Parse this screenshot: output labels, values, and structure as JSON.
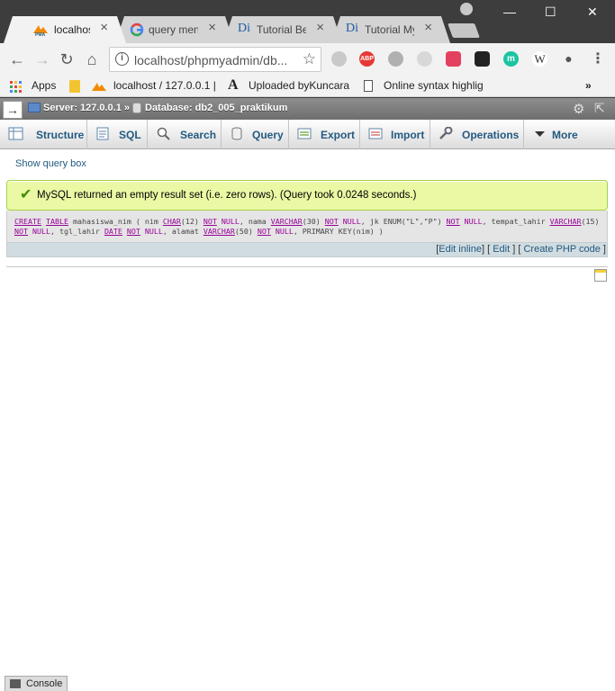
{
  "browser": {
    "tabs": [
      {
        "title": "localhost /",
        "active": true
      },
      {
        "title": "query men",
        "active": false
      },
      {
        "title": "Tutorial Be",
        "active": false
      },
      {
        "title": "Tutorial My",
        "active": false
      }
    ],
    "close_glyph": "×",
    "controls": {
      "minimize": "—",
      "maximize": "☐",
      "close": "✕"
    },
    "url": "localhost/phpmyadmin/db...",
    "extensions": [
      "ABP",
      "W",
      "m"
    ],
    "bookmarks": {
      "apps": "Apps",
      "pma": "localhost / 127.0.0.1 |",
      "uploaded": "Uploaded byKuncara",
      "online": "Online syntax highlig",
      "more": "»"
    }
  },
  "pma": {
    "breadcrumb": {
      "server": "Server: 127.0.0.1 »",
      "database": "Database: db2_005_praktikum"
    },
    "menu": [
      {
        "label": "Structure",
        "icon": "structure-icon"
      },
      {
        "label": "SQL",
        "icon": "sql-icon"
      },
      {
        "label": "Search",
        "icon": "search-icon"
      },
      {
        "label": "Query",
        "icon": "query-icon"
      },
      {
        "label": "Export",
        "icon": "export-icon"
      },
      {
        "label": "Import",
        "icon": "import-icon"
      },
      {
        "label": "Operations",
        "icon": "wrench-icon"
      },
      {
        "label": "More",
        "icon": "chevron-down-icon"
      }
    ],
    "show_query_box": "Show query box",
    "success_message": "MySQL returned an empty result set (i.e. zero rows). (Query took 0.0248 seconds.)",
    "sql_query": "CREATE TABLE mahasiswa_nim ( nim CHAR(12) NOT NULL, nama VARCHAR(30) NOT NULL, jk ENUM(\"L\",\"P\") NOT NULL, tempat_lahir VARCHAR(15) NOT NULL, tgl_lahir DATE NOT NULL, alamat VARCHAR(50) NOT NULL, PRIMARY KEY(nim) )",
    "sql_tokens": {
      "create": "CREATE",
      "table": "TABLE",
      "name": "mahasiswa_nim ( nim ",
      "char": "CHAR",
      "char_args": "(12) ",
      "not": "NOT",
      "null": "NULL",
      "nama": ", nama ",
      "varchar": "VARCHAR",
      "v30": "(30) ",
      "jk": ", jk ENUM(\"L\",\"P\") ",
      "tempat": ", tempat_lahir ",
      "v15": "(15)",
      "tgl": ", tgl_lahir ",
      "date": "DATE",
      "alamat": ", alamat ",
      "v50": "(50) ",
      "pk": ", PRIMARY KEY(nim) )"
    },
    "tools": {
      "edit_inline": "Edit inline",
      "edit": "Edit",
      "create_php": "Create PHP code"
    },
    "console_label": "Console"
  },
  "colors": {
    "link": "#235a81",
    "success_bg": "#ebf8a4",
    "success_border": "#a2d246",
    "sql_keyword": "#990099"
  }
}
